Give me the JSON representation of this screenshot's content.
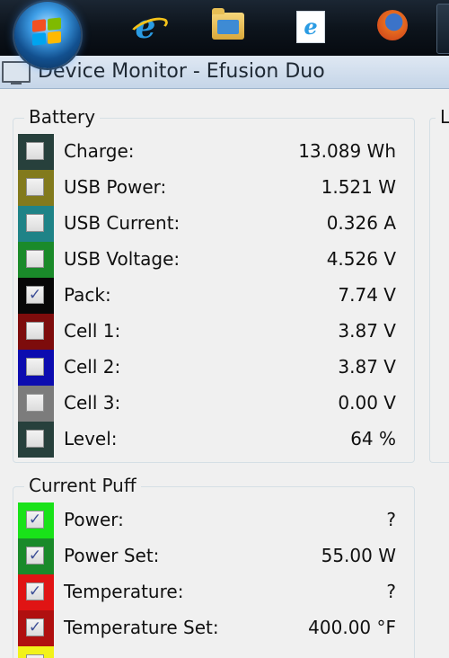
{
  "taskbar": {
    "icons": [
      "start-orb",
      "internet-explorer-icon",
      "windows-explorer-icon",
      "internet-explorer-document-icon",
      "firefox-icon"
    ]
  },
  "window": {
    "title": "Device Monitor - Efusion Duo"
  },
  "battery": {
    "label": "Battery",
    "rows": [
      {
        "label": "Charge:",
        "value": "13.089 Wh",
        "color": "#27403c",
        "checked": false
      },
      {
        "label": "USB Power:",
        "value": "1.521 W",
        "color": "#827a1d",
        "checked": false
      },
      {
        "label": "USB Current:",
        "value": "0.326 A",
        "color": "#1f8387",
        "checked": false
      },
      {
        "label": "USB Voltage:",
        "value": "4.526 V",
        "color": "#1a8a2a",
        "checked": false
      },
      {
        "label": "Pack:",
        "value": "7.74 V",
        "color": "#070707",
        "checked": true
      },
      {
        "label": "Cell 1:",
        "value": "3.87 V",
        "color": "#7d0c0c",
        "checked": false
      },
      {
        "label": "Cell 2:",
        "value": "3.87 V",
        "color": "#0c0cb0",
        "checked": false
      },
      {
        "label": "Cell 3:",
        "value": "0.00 V",
        "color": "#7c7c7c",
        "checked": false
      },
      {
        "label": "Level:",
        "value": "64 %",
        "color": "#27403c",
        "checked": false
      }
    ]
  },
  "second_column": {
    "label": "L"
  },
  "current_puff": {
    "label": "Current Puff",
    "rows": [
      {
        "label": "Power:",
        "value": "?",
        "color": "#19e219",
        "checked": true
      },
      {
        "label": "Power Set:",
        "value": "55.00 W",
        "color": "#1a8a2a",
        "checked": true
      },
      {
        "label": "Temperature:",
        "value": "?",
        "color": "#e01414",
        "checked": true
      },
      {
        "label": "Temperature Set:",
        "value": "400.00 °F",
        "color": "#b01010",
        "checked": true
      },
      {
        "label": "",
        "value": "",
        "color": "#f2f21a",
        "checked": false
      }
    ]
  }
}
